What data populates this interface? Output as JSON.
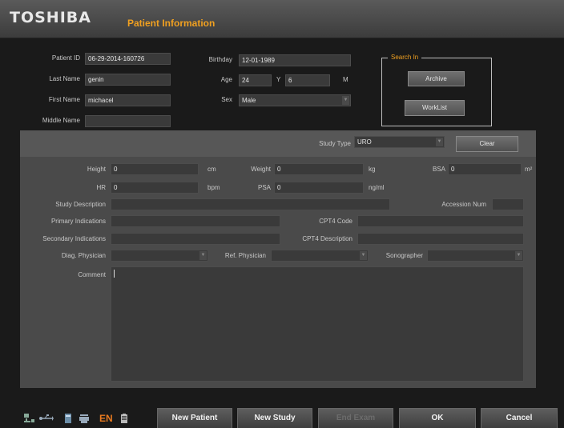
{
  "header": {
    "logo": "TOSHIBA",
    "title": "Patient Information"
  },
  "patient": {
    "id_label": "Patient ID",
    "id_value": "06-29-2014-160726",
    "last_label": "Last Name",
    "last_value": "genin",
    "first_label": "First Name",
    "first_value": "michacel",
    "middle_label": "Middle Name",
    "middle_value": "",
    "birthday_label": "Birthday",
    "birthday_value": "12-01-1989",
    "age_label": "Age",
    "age_value": "24",
    "age_y": "Y",
    "age_m_value": "6",
    "age_m": "M",
    "sex_label": "Sex",
    "sex_value": "Male"
  },
  "search": {
    "title": "Search In",
    "archive": "Archive",
    "worklist": "WorkList"
  },
  "study": {
    "type_label": "Study Type",
    "type_value": "URO",
    "clear": "Clear"
  },
  "measure": {
    "height_label": "Height",
    "height_value": "0",
    "height_unit": "cm",
    "weight_label": "Weight",
    "weight_value": "0",
    "weight_unit": "kg",
    "bsa_label": "BSA",
    "bsa_value": "0",
    "bsa_unit": "m²",
    "hr_label": "HR",
    "hr_value": "0",
    "hr_unit": "bpm",
    "psa_label": "PSA",
    "psa_value": "0",
    "psa_unit": "ng/ml"
  },
  "info": {
    "desc_label": "Study Description",
    "accession_label": "Accession Num",
    "primary_label": "Primary Indications",
    "cpt4code_label": "CPT4 Code",
    "secondary_label": "Secondary Indications",
    "cpt4desc_label": "CPT4 Description",
    "diag_label": "Diag. Physician",
    "ref_label": "Ref. Physician",
    "sono_label": "Sonographer",
    "comment_label": "Comment"
  },
  "footer": {
    "en": "EN",
    "new_patient": "New Patient",
    "new_study": "New Study",
    "end_exam": "End Exam",
    "ok": "OK",
    "cancel": "Cancel"
  }
}
